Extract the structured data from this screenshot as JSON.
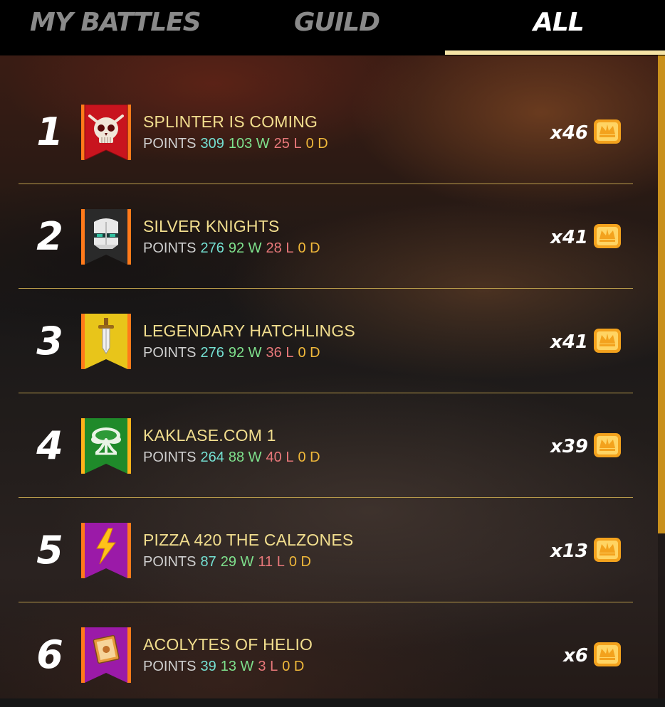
{
  "tabs": {
    "my_battles": "MY BATTLES",
    "guild": "GUILD",
    "all": "ALL",
    "active": "ALL"
  },
  "stat_labels": {
    "points": "POINTS",
    "wins_suffix": "W",
    "losses_suffix": "L",
    "draws_suffix": "D"
  },
  "colors": {
    "name": "#f2de8e",
    "points": "#74e0d2",
    "wins": "#7ee08c",
    "losses": "#e8787a",
    "draws": "#f0b83a",
    "tab_underline": "#f5e3a6",
    "scrollbar": "#c9901c"
  },
  "rows": [
    {
      "rank": "1",
      "name": "SPLINTER IS COMING",
      "points": "309",
      "wins": "103 W",
      "losses": "25 L",
      "draws": "0 D",
      "reward": "x46",
      "banner_color": "#c8141e",
      "emblem": "skull-icon"
    },
    {
      "rank": "2",
      "name": "SILVER KNIGHTS",
      "points": "276",
      "wins": "92 W",
      "losses": "28 L",
      "draws": "0 D",
      "reward": "x41",
      "banner_color": "#2a2a2a",
      "emblem": "knight-helmet-icon"
    },
    {
      "rank": "3",
      "name": "LEGENDARY HATCHLINGS",
      "points": "276",
      "wins": "92 W",
      "losses": "36 L",
      "draws": "0 D",
      "reward": "x41",
      "banner_color": "#e8c51a",
      "emblem": "sword-icon"
    },
    {
      "rank": "4",
      "name": "KAKLASE.COM 1",
      "points": "264",
      "wins": "88 W",
      "losses": "40 L",
      "draws": "0 D",
      "reward": "x39",
      "banner_color": "#1f8a2a",
      "emblem": "tree-icon"
    },
    {
      "rank": "5",
      "name": "PIZZA 420 THE CALZONES",
      "points": "87",
      "wins": "29 W",
      "losses": "11 L",
      "draws": "0 D",
      "reward": "x13",
      "banner_color": "#9b1aa8",
      "emblem": "lightning-icon"
    },
    {
      "rank": "6",
      "name": "ACOLYTES OF HELIO",
      "points": "39",
      "wins": "13 W",
      "losses": "3 L",
      "draws": "0 D",
      "reward": "x6",
      "banner_color": "#9b1aa8",
      "emblem": "book-icon"
    }
  ]
}
